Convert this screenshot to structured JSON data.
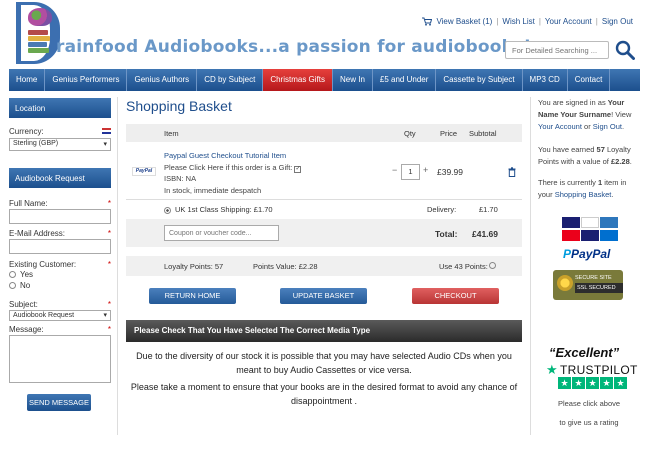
{
  "brand": {
    "logo_text": "rainfood Audiobooks...a passion for audiobooks!"
  },
  "toplinks": {
    "basket": "View Basket (1)",
    "wishlist": "Wish List",
    "account": "Your Account",
    "signout": "Sign Out"
  },
  "search": {
    "placeholder": "For Detailed Searching ..."
  },
  "nav": [
    "Home",
    "Genius Performers",
    "Genius Authors",
    "CD by Subject",
    "Christmas Gifts",
    "New In",
    "£5 and Under",
    "Cassette by Subject",
    "MP3 CD",
    "Contact"
  ],
  "nav_active": "Christmas Gifts",
  "left": {
    "location_heading": "Location",
    "currency_label": "Currency:",
    "currency_value": "Sterling (GBP)",
    "request_heading": "Audiobook Request",
    "fullname_label": "Full Name:",
    "email_label": "E-Mail Address:",
    "existing_label": "Existing Customer:",
    "yes": "Yes",
    "no": "No",
    "subject_label": "Subject:",
    "subject_value": "Audiobook Request",
    "message_label": "Message:",
    "required_mark": "*",
    "send_button": "SEND MESSAGE"
  },
  "basket": {
    "title": "Shopping Basket",
    "col_item": "Item",
    "col_qty": "Qty",
    "col_price": "Price",
    "col_subtotal": "Subtotal",
    "item_name": "Paypal Guest Checkout Tutorial Item",
    "gift_text": "Please Click Here if this order is a Gift:",
    "isbn": "ISBN: NA",
    "stock": "In stock, immediate despatch",
    "thumb_text": "PayPal",
    "qty": "1",
    "qty_minus": "−",
    "qty_plus": "+",
    "price": "£39.99",
    "shipping_label": "UK 1st Class Shipping: £1.70",
    "delivery_label": "Delivery:",
    "delivery_value": "£1.70",
    "coupon_placeholder": "Coupon or voucher code...",
    "total_label": "Total:",
    "total_value": "£41.69",
    "loyalty_points": "Loyalty Points:  57",
    "points_value": "Points Value:  £2.28",
    "use_points": "Use 43 Points:",
    "return_home": "RETURN HOME",
    "update_basket": "UPDATE BASKET",
    "checkout": "CHECKOUT"
  },
  "notice": {
    "heading": "Please Check That You Have Selected The Correct Media Type",
    "p1": "Due to the diversity of our stock it is possible that you may have selected Audio CDs when you meant to buy Audio Cassettes or vice versa.",
    "p2": "Please take a moment to ensure that your books are in the desired format to avoid any chance of disappointment ."
  },
  "right": {
    "signed_in_1": "You are signed in as",
    "signed_in_name": "Your Name Your Surname",
    "signed_in_2": "! View",
    "signed_in_account": "Your Account",
    "signed_in_or": " or ",
    "signed_in_signout": "Sign Out",
    "signed_in_end": ".",
    "earned_1": "You have earned ",
    "earned_points": "57",
    "earned_2": " Loyalty Points with a value of ",
    "earned_value": "£2.28",
    "earned_end": ".",
    "basket_1": "There is currently ",
    "basket_count": "1",
    "basket_2": " item in your ",
    "basket_link": "Shopping Basket",
    "basket_end": ".",
    "paypal_text": "PayPal",
    "secure_text": "SECURE SITE",
    "ssl_text": "SSL SECURED",
    "excellent": "“Excellent”",
    "trustpilot": "TRUSTPILOT",
    "click_above": "Please click above",
    "give_rating": "to give us a rating"
  },
  "colors": {
    "nav_blue": "#1c4f8d",
    "active_red": "#c8201f",
    "trust_green": "#00b67a"
  }
}
